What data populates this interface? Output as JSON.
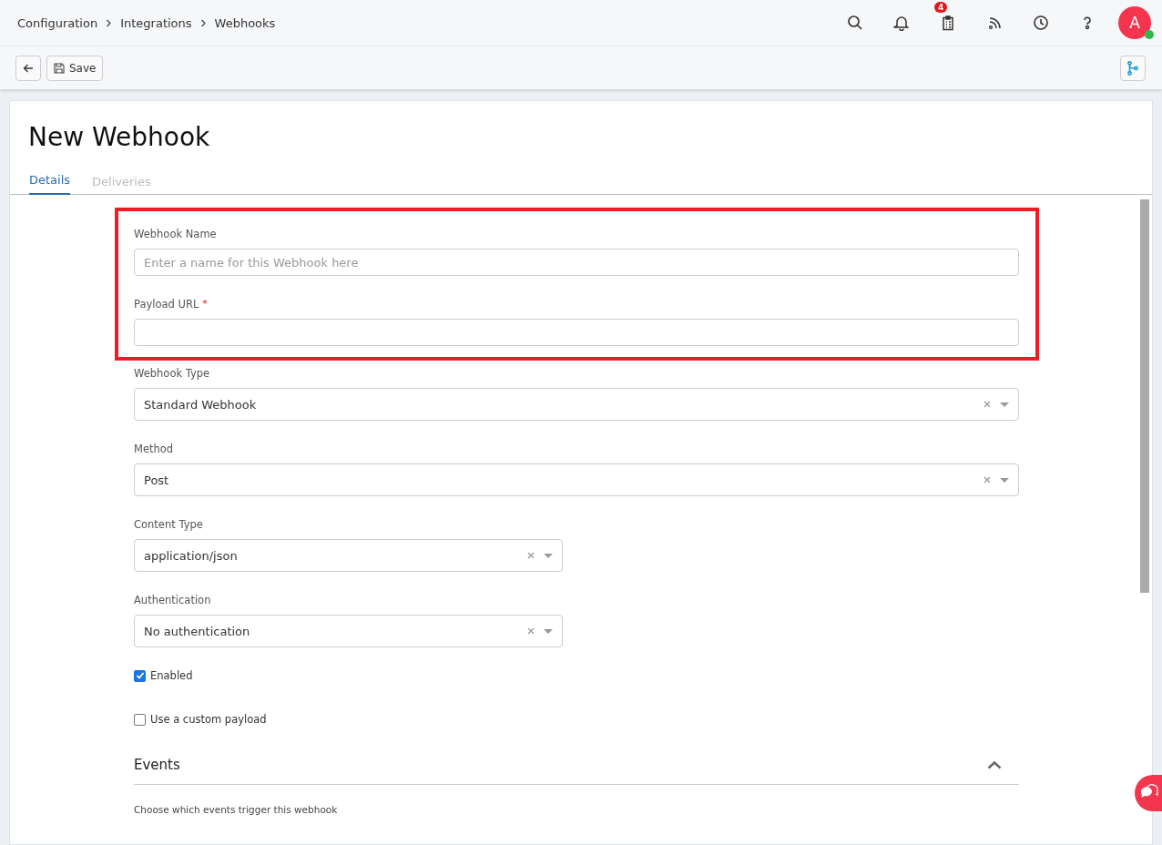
{
  "breadcrumb": [
    "Configuration",
    "Integrations",
    "Webhooks"
  ],
  "header": {
    "notification_count": "4",
    "avatar_letter": "A",
    "online": true
  },
  "toolbar": {
    "save_label": "Save"
  },
  "page_title": "New Webhook",
  "tabs": [
    {
      "label": "Details",
      "selected": true
    },
    {
      "label": "Deliveries",
      "selected": false
    }
  ],
  "highlight_frame": {
    "fields": [
      {
        "kind": "text",
        "label": "Webhook Name",
        "placeholder": "Enter a name for this Webhook here"
      },
      {
        "kind": "text",
        "label": "Payload URL",
        "required": true,
        "required_mark": "*"
      }
    ]
  },
  "fields": [
    {
      "kind": "select",
      "label": "Webhook Type",
      "value": "Standard Webhook"
    },
    {
      "kind": "select",
      "label": "Method",
      "value": "Post"
    },
    {
      "kind": "compact-select",
      "label": "Content Type",
      "value": "application/json"
    },
    {
      "kind": "compact-select",
      "label": "Authentication",
      "value": "No authentication"
    }
  ],
  "checkboxes": [
    {
      "label": "Enabled",
      "checked": true
    },
    {
      "label": "Use a custom payload",
      "checked": false
    }
  ],
  "events": {
    "title": "Events",
    "expanded": true,
    "description": "Choose which events trigger this webhook"
  }
}
